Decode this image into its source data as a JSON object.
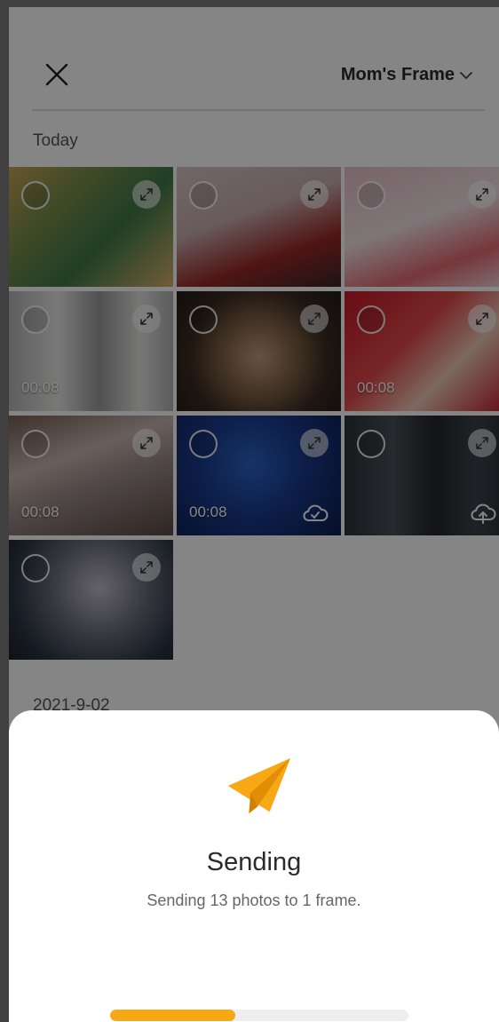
{
  "header": {
    "frame_name": "Mom's Frame"
  },
  "sections": [
    {
      "title": "Today"
    },
    {
      "title": "2021-9-02"
    }
  ],
  "photos": [
    {
      "bg": "linear-gradient(135deg,#c7a457 0%,#6f8b4a 35%,#3e7a4a 60%,#d9b36a 100%)",
      "duration": "",
      "cloud": ""
    },
    {
      "bg": "linear-gradient(160deg,#d9c5c5 0%,#c9aeb0 40%,#9a2a28 70%,#3b2528 100%)",
      "duration": "",
      "cloud": ""
    },
    {
      "bg": "linear-gradient(160deg,#e7bfc9 0%,#f1e3e6 45%,#e26a72 75%,#f3d7de 100%)",
      "duration": "",
      "cloud": ""
    },
    {
      "bg": "linear-gradient(90deg,#b6b6b7 0%,#e8e8e6 30%,#9b9b9c 55%,#e4e4e2 80%,#b0b0b2 100%)",
      "duration": "00:08",
      "cloud": ""
    },
    {
      "bg": "radial-gradient(circle at 50% 55%,#c29e7e 0%,#8a6a4c 30%,#3c2c22 65%,#1f1a16 100%)",
      "duration": "",
      "cloud": ""
    },
    {
      "bg": "linear-gradient(135deg,#c8192a 0%,#e24a4a 40%,#efc9b6 65%,#c3172a 100%)",
      "duration": "00:08",
      "cloud": ""
    },
    {
      "bg": "linear-gradient(160deg,#7a5f55 0%,#c8b7b1 35%,#9d8d8a 55%,#5a4a45 100%)",
      "duration": "00:08",
      "cloud": ""
    },
    {
      "bg": "radial-gradient(circle at 45% 40%,#2b63c7 0%,#1a3a8c 45%,#0d1d4f 100%)",
      "duration": "00:08",
      "cloud": "check"
    },
    {
      "bg": "linear-gradient(90deg,#2d3238 0%,#4a5058 30%,#22262b 55%,#3c424a 80%,#2a2f35 100%)",
      "duration": "",
      "cloud": "upload"
    },
    {
      "bg": "radial-gradient(circle at 55% 40%,#c3bdc9 0%,#6b6f7d 40%,#2c3442 75%,#1c222b 100%)",
      "duration": "",
      "cloud": ""
    }
  ],
  "sending": {
    "title": "Sending",
    "subtitle": "Sending 13 photos to 1 frame.",
    "progress": 0.42,
    "accent": "#f7a814"
  }
}
